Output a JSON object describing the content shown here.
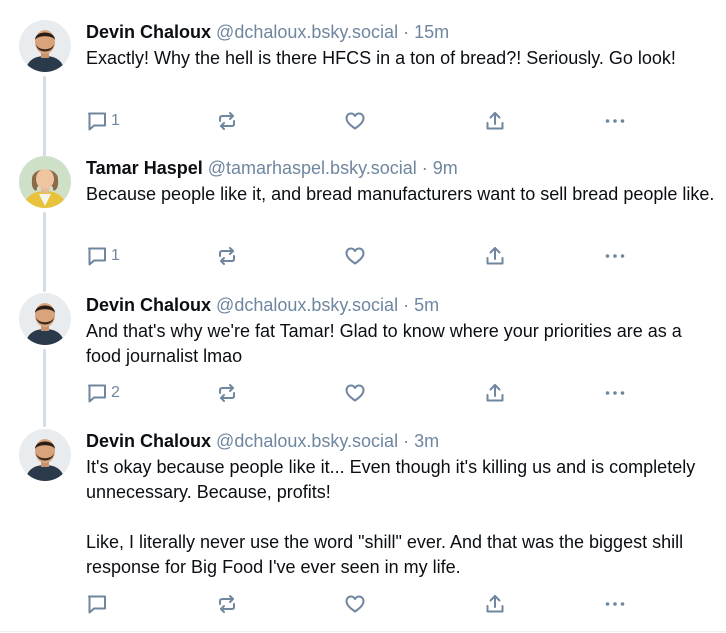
{
  "posts": [
    {
      "author": "Devin Chaloux",
      "handle": "@dchaloux.bsky.social",
      "separator": "·",
      "time": "15m",
      "text_lines": [
        "Exactly! Why the hell is there HFCS in a ton of bread?! Seriously. Go look!"
      ],
      "reply_count": "1",
      "avatar": "devin-avatar"
    },
    {
      "author": "Tamar Haspel",
      "handle": "@tamarhaspel.bsky.social",
      "separator": "·",
      "time": "9m",
      "text_lines": [
        "Because people like it, and bread manufacturers want to sell bread people like."
      ],
      "reply_count": "1",
      "avatar": "tamar-avatar"
    },
    {
      "author": "Devin Chaloux",
      "handle": "@dchaloux.bsky.social",
      "separator": "·",
      "time": "5m",
      "text_lines": [
        "And that's why we're fat Tamar! Glad to know where your priorities are as a food journalist lmao"
      ],
      "reply_count": "2",
      "avatar": "devin-avatar"
    },
    {
      "author": "Devin Chaloux",
      "handle": "@dchaloux.bsky.social",
      "separator": "·",
      "time": "3m",
      "text_lines": [
        "It's okay because people like it... Even though it's killing us and is completely unnecessary. Because, profits!",
        "Like, I literally never use the word \"shill\" ever. And that was the biggest shill response for Big Food I've ever seen in my life."
      ],
      "reply_count": "",
      "avatar": "devin-avatar"
    }
  ],
  "icons": {
    "reply": "speech-bubble-icon",
    "repost": "repost-arrows-icon",
    "like": "heart-icon",
    "share": "share-upload-icon",
    "more": "ellipsis-icon"
  },
  "colors": {
    "text": "#0b0f14",
    "muted": "#6f869f",
    "thread_line": "#d4dbe2"
  }
}
